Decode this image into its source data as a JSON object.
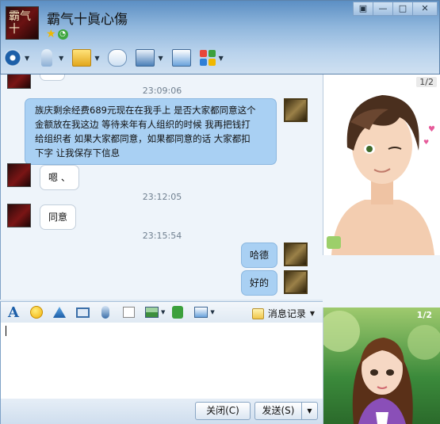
{
  "window": {
    "contact_name": "霸气十眞心傷",
    "avatar_text": "霸气十",
    "controls": {
      "menu": "▣",
      "minimize": "—",
      "maximize": "□",
      "close": "✕"
    }
  },
  "toolbar": {
    "items": [
      {
        "icon": "video-call-icon"
      },
      {
        "icon": "voice-call-icon"
      },
      {
        "icon": "send-file-icon"
      },
      {
        "icon": "create-discussion-icon"
      },
      {
        "icon": "remote-assist-icon"
      },
      {
        "icon": "share-screen-icon"
      },
      {
        "icon": "apps-icon"
      }
    ]
  },
  "chat": {
    "messages": [
      {
        "time": "23:09:06"
      },
      {
        "sender": "me",
        "text": "族庆剩余经费689元现在在我手上 是否大家都同意这个金额放在我这边 等待来年有人组织的时候 我再把钱打给组织者 如果大家都同意，如果都同意的话 大家都扣下字 让我保存下信息"
      },
      {
        "sender": "them",
        "text": "嗯 、"
      },
      {
        "time": "23:12:05"
      },
      {
        "sender": "them",
        "text": "同意"
      },
      {
        "time": "23:15:54"
      },
      {
        "sender": "me",
        "text": "哈德"
      },
      {
        "sender": "me",
        "text": "好的"
      }
    ],
    "msg_long_lines": [
      "族庆剩余经费689元现在在我手上 是否大家都同意这个",
      "金额放在我这边 等待来年有人组织的时候 我再把钱打",
      "给组织者 如果大家都同意，如果都同意的话 大家都扣",
      "下字 让我保存下信息"
    ],
    "time_1": "23:09:06",
    "time_2": "23:12:05",
    "time_3": "23:15:54",
    "msg_reply_1": "嗯 、",
    "msg_reply_2": "同意",
    "msg_me_1": "哈德",
    "msg_me_2": "好的"
  },
  "input_toolbar": {
    "history_label": "消息记录"
  },
  "input": {
    "value": ""
  },
  "buttons": {
    "close_label": "关闭(C)",
    "send_label": "发送(S)",
    "send_arrow": "▼"
  },
  "show_panels": {
    "top_page": "1/2",
    "bottom_page": "1/2"
  }
}
